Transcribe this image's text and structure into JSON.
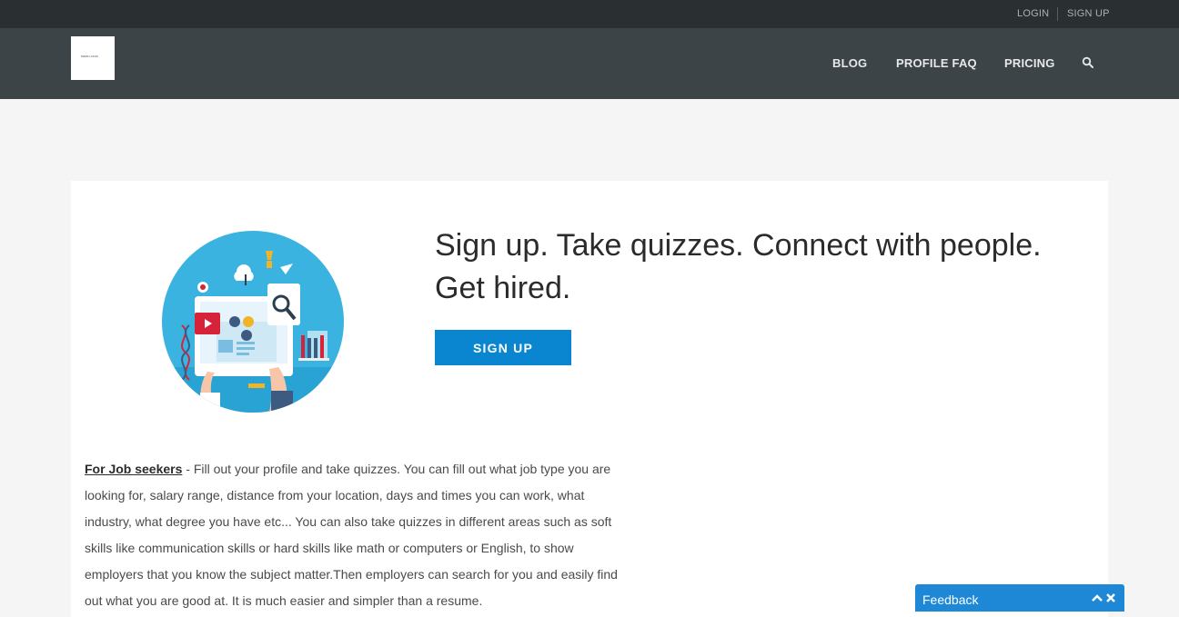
{
  "topbar": {
    "login": "LOGIN",
    "signup": "SIGN UP"
  },
  "navbar": {
    "logo_text": "MARK LOGIN",
    "items": [
      "BLOG",
      "PROFILE FAQ",
      "PRICING"
    ],
    "search_icon": "search-icon"
  },
  "hero": {
    "headline": "Sign up. Take quizzes. Connect with people. Get hired.",
    "button": "SIGN UP",
    "illustration": "job-skills-illustration"
  },
  "body": {
    "lead": "For Job seekers",
    "text": " - Fill out your profile and take quizzes. You can fill out what job type you are looking for, salary range, distance from your location, days and times you can work, what industry, what degree you have etc... You can also take quizzes in different areas such as soft skills like communication skills or hard skills like math or computers or English, to show employers that you know the subject matter.Then employers can search for you and easily find out what you are good at. It is much easier and simpler than a resume."
  },
  "feedback": {
    "label": "Feedback",
    "icons": [
      "chevron-up-icon",
      "close-icon"
    ]
  },
  "colors": {
    "topbar": "#2a2f32",
    "navbar": "#3d4447",
    "accent": "#0a86d0",
    "feedback": "#1e88d6"
  }
}
